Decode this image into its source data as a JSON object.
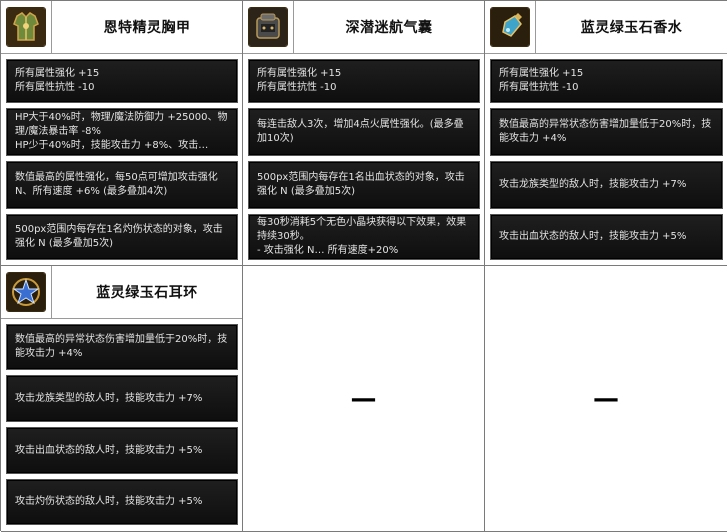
{
  "items": [
    {
      "title": "恩特精灵胸甲",
      "icon": "chest-armor-icon",
      "stats": [
        "所有属性强化 +15\n所有属性抗性 -10",
        "HP大于40%时，物理/魔法防御力 +25000、物理/魔法暴击率 -8%\nHP少于40%时，技能攻击力 +8%、攻击…",
        "数值最高的属性强化，每50点可增加攻击强化 N、所有速度 +6% (最多叠加4次)",
        "500px范围内每存在1名灼伤状态的对象，攻击强化 N (最多叠加5次)"
      ]
    },
    {
      "title": "深潜迷航气囊",
      "icon": "airbag-pack-icon",
      "stats": [
        "所有属性强化 +15\n所有属性抗性 -10",
        "每连击敌人3次，增加4点火属性强化。(最多叠加10次)",
        "500px范围内每存在1名出血状态的对象，攻击强化 N (最多叠加5次)",
        "每30秒消耗5个无色小晶块获得以下效果，效果持续30秒。\n- 攻击强化 N… 所有速度+20%"
      ]
    },
    {
      "title": "蓝灵绿玉石香水",
      "icon": "perfume-bottle-icon",
      "stats": [
        "所有属性强化 +15\n所有属性抗性 -10",
        "数值最高的异常状态伤害增加量低于20%时，技能攻击力 +4%",
        "攻击龙族类型的敌人时，技能攻击力 +7%",
        "攻击出血状态的敌人时，技能攻击力 +5%"
      ]
    },
    {
      "title": "蓝灵绿玉石耳环",
      "icon": "star-earring-icon",
      "stats": [
        "数值最高的异常状态伤害增加量低于20%时，技能攻击力 +4%",
        "攻击龙族类型的敌人时，技能攻击力 +7%",
        "攻击出血状态的敌人时，技能攻击力 +5%",
        "攻击灼伤状态的敌人时，技能攻击力 +5%"
      ]
    }
  ],
  "empty_cells": [
    "—",
    "—"
  ]
}
